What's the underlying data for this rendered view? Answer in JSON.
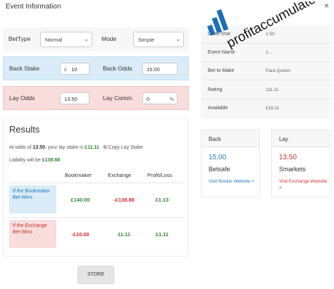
{
  "modal": {
    "title": "Event Information",
    "close": "×"
  },
  "form": {
    "bettype_label": "BetType",
    "bettype_value": "Normal",
    "mode_label": "Mode",
    "mode_value": "Simple",
    "back_stake_label": "Back Stake",
    "back_stake_prefix": "£",
    "back_stake_value": "10",
    "back_odds_label": "Back Odds",
    "back_odds_value": "15.00",
    "lay_odds_label": "Lay Odds",
    "lay_odds_value": "13.50",
    "lay_comm_label": "Lay Comm.",
    "lay_comm_value": "0",
    "lay_comm_suffix": "%"
  },
  "results": {
    "title": "Results",
    "odds_prefix": "At odds of",
    "odds_value": "13.50",
    "odds_middle": ", your lay stake is",
    "lay_stake": "£11.11",
    "copy_label": "Copy Lay Stake",
    "liability_prefix": "Liability will be",
    "liability": "£138.88",
    "headers": {
      "bookmaker": "Bookmaker",
      "exchange": "Exchange",
      "profit": "Profit/Loss"
    },
    "rows": [
      {
        "label": "If the Bookmaker Bet Wins",
        "bookmaker": "£140.00",
        "exchange": "-£138.88",
        "profit": "£1.13"
      },
      {
        "label": "If the Exchange Bet Wins",
        "bookmaker": "-£10.00",
        "exchange": "11.11",
        "profit": "£1.11"
      }
    ]
  },
  "store_label": "STORE",
  "event": [
    {
      "key": "Date/Time",
      "value": "1:50"
    },
    {
      "key": "Event Name",
      "value": "1..."
    },
    {
      "key": "Bet to Make",
      "value": "Para Queen"
    },
    {
      "key": "Rating",
      "value": "111.11"
    },
    {
      "key": "Available",
      "value": "£18.11"
    }
  ],
  "back_card": {
    "header": "Back",
    "odds": "15.00",
    "name": "Betsafe",
    "link": "Visit Bookie Website >"
  },
  "lay_card": {
    "header": "Lay",
    "odds": "13.50",
    "name": "Smarkets",
    "link": "Visit Exchange Website >"
  },
  "logo_text": "profitaccumulator",
  "colors": {
    "back_blue": "#2277bb",
    "lay_red": "#d32f2f",
    "profit_green": "#2e8b2e",
    "logo_blue": "#1b6fb8"
  }
}
